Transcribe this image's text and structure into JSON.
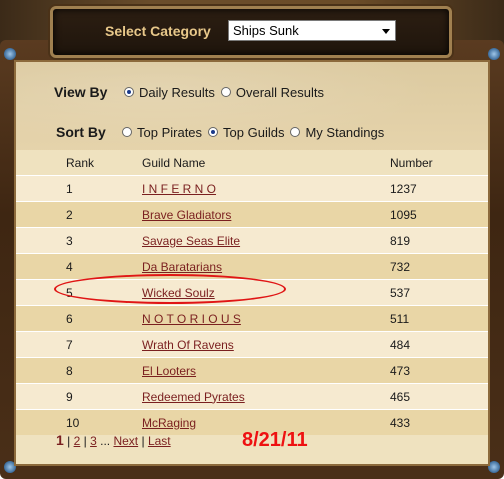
{
  "header": {
    "category_label": "Select Category",
    "category_selected": "Ships Sunk"
  },
  "view_by": {
    "label": "View By",
    "options": [
      {
        "label": "Daily Results",
        "selected": true
      },
      {
        "label": "Overall Results",
        "selected": false
      }
    ]
  },
  "sort_by": {
    "label": "Sort By",
    "options": [
      {
        "label": "Top Pirates",
        "selected": false
      },
      {
        "label": "Top Guilds",
        "selected": true
      },
      {
        "label": "My Standings",
        "selected": false
      }
    ]
  },
  "table": {
    "headers": {
      "rank": "Rank",
      "guild": "Guild Name",
      "number": "Number"
    },
    "rows": [
      {
        "rank": "1",
        "guild": "I N F E R N O",
        "number": "1237"
      },
      {
        "rank": "2",
        "guild": "Brave Gladiators",
        "number": "1095"
      },
      {
        "rank": "3",
        "guild": "Savage Seas Elite",
        "number": "819"
      },
      {
        "rank": "4",
        "guild": "Da Baratarians",
        "number": "732"
      },
      {
        "rank": "5",
        "guild": "Wicked Soulz",
        "number": "537"
      },
      {
        "rank": "6",
        "guild": "N O T O R I O U S",
        "number": "511"
      },
      {
        "rank": "7",
        "guild": "Wrath Of Ravens",
        "number": "484"
      },
      {
        "rank": "8",
        "guild": "El Looters",
        "number": "473"
      },
      {
        "rank": "9",
        "guild": "Redeemed Pyrates",
        "number": "465"
      },
      {
        "rank": "10",
        "guild": "McRaging",
        "number": "433"
      }
    ]
  },
  "pager": {
    "current": "1",
    "page2": "2",
    "page3": "3",
    "ellipsis": "...",
    "next": "Next",
    "last": "Last"
  },
  "date_stamp": "8/21/11",
  "colors": {
    "highlight": "#e01515",
    "link": "#7a1f1f",
    "date": "#ee1111"
  }
}
